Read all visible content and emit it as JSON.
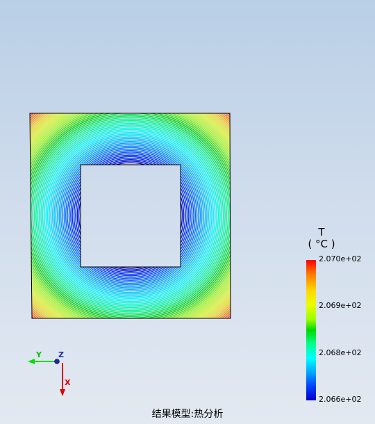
{
  "legend": {
    "variable": "T",
    "unit": "( °C )",
    "ticks": [
      "2.070e+02",
      "2.069e+02",
      "2.068e+02",
      "2.066e+02"
    ]
  },
  "triad": {
    "y_label": "Y",
    "z_label": "Z",
    "x_label": "X"
  },
  "status_text": "结果模型:热分析",
  "colors": {
    "hot": "#ff0000",
    "warm": "#ffd800",
    "mid": "#00d800",
    "cool": "#00ffff",
    "cold": "#0000c8",
    "outline": "#000000"
  }
}
